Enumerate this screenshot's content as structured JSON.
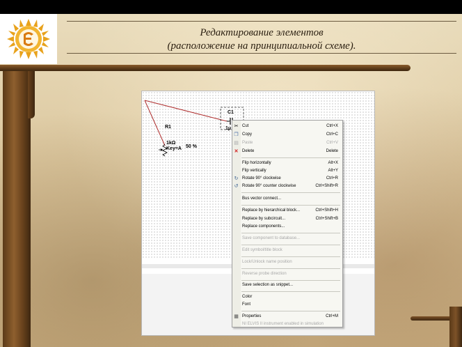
{
  "slide": {
    "title_line1": "Редактирование элементов",
    "title_line2": "(расположение на принципиальной схеме)."
  },
  "circuit": {
    "capacitor_label": "C1",
    "capacitor_value": "1μ",
    "resistor_label": "R1",
    "resistor_value": "1kΩ",
    "resistor_key": "Key=A",
    "resistor_percent": "50 %"
  },
  "context_menu": {
    "items": [
      {
        "label": "Cut",
        "shortcut": "Ctrl+X",
        "icon": "scissors-icon",
        "disabled": false
      },
      {
        "label": "Copy",
        "shortcut": "Ctrl+C",
        "icon": "copy-icon",
        "disabled": false
      },
      {
        "label": "Paste",
        "shortcut": "Ctrl+V",
        "icon": "paste-icon",
        "disabled": true
      },
      {
        "label": "Delete",
        "shortcut": "Delete",
        "icon": "delete-x-icon",
        "disabled": false
      },
      {
        "label": "Flip horizontally",
        "shortcut": "Alt+X",
        "icon": "",
        "disabled": false
      },
      {
        "label": "Flip vertically",
        "shortcut": "Alt+Y",
        "icon": "",
        "disabled": false
      },
      {
        "label": "Rotate 90° clockwise",
        "shortcut": "Ctrl+R",
        "icon": "rotate-clockwise-icon",
        "disabled": false
      },
      {
        "label": "Rotate 90° counter clockwise",
        "shortcut": "Ctrl+Shift+R",
        "icon": "rotate-counterclockwise-icon",
        "disabled": false
      },
      {
        "label": "Bus vector connect...",
        "shortcut": "",
        "icon": "",
        "disabled": false
      },
      {
        "label": "Replace by hierarchical block...",
        "shortcut": "Ctrl+Shift+H",
        "icon": "",
        "disabled": false
      },
      {
        "label": "Replace by subcircuit...",
        "shortcut": "Ctrl+Shift+B",
        "icon": "",
        "disabled": false
      },
      {
        "label": "Replace components...",
        "shortcut": "",
        "icon": "",
        "disabled": false
      },
      {
        "label": "Save component to database...",
        "shortcut": "",
        "icon": "",
        "disabled": true
      },
      {
        "label": "Edit symbol/title block",
        "shortcut": "",
        "icon": "",
        "disabled": true
      },
      {
        "label": "Lock/Unlock name position",
        "shortcut": "",
        "icon": "",
        "disabled": true
      },
      {
        "label": "Reverse probe direction",
        "shortcut": "",
        "icon": "",
        "disabled": true
      },
      {
        "label": "Save selection as snippet...",
        "shortcut": "",
        "icon": "",
        "disabled": false
      },
      {
        "label": "Color",
        "shortcut": "",
        "icon": "",
        "disabled": false
      },
      {
        "label": "Font",
        "shortcut": "",
        "icon": "",
        "disabled": false
      },
      {
        "label": "Properties",
        "shortcut": "Ctrl+M",
        "icon": "properties-icon",
        "disabled": false
      },
      {
        "label": "NI ELVIS II instrument enabled in simulation",
        "shortcut": "",
        "icon": "",
        "disabled": true
      }
    ]
  },
  "colors": {
    "wire": "#b03030",
    "menu_background": "#f7f7f2",
    "disabled_text": "#a8a8a8"
  }
}
